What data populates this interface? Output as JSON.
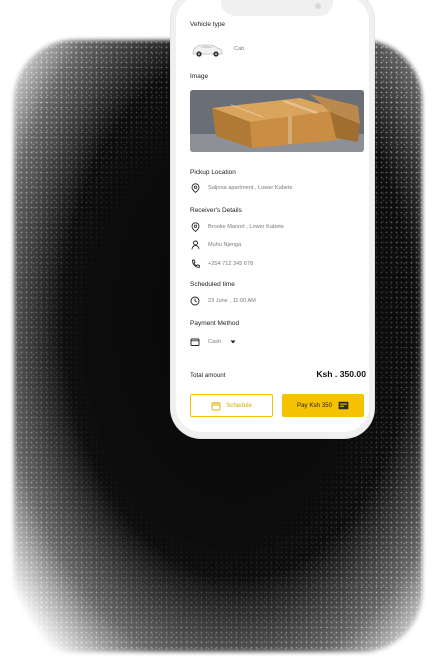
{
  "vehicle": {
    "title": "Vehicle type",
    "type": "Cab"
  },
  "image": {
    "title": "Image"
  },
  "pickup": {
    "title": "Pickup Location",
    "address": "Saljona apartment , Lower Kabete"
  },
  "receiver": {
    "title": "Receiver's Details",
    "address": "Brooke Manort , Lower Kabete",
    "name": "Muhu Njenga",
    "phone": "+254 712 345 678"
  },
  "schedule": {
    "title": "Scheduled time",
    "time": "23 June , 11:00 AM"
  },
  "payment": {
    "title": "Payment Method",
    "method": "Cash"
  },
  "total": {
    "label": "Total amount",
    "value": "Ksh . 350.00"
  },
  "actions": {
    "schedule_label": "Schedule",
    "pay_label": "Pay Ksh 350"
  },
  "colors": {
    "accent": "#f5c200",
    "muted_text": "#7a7a7a"
  },
  "icons": {
    "pickup": "location-pin-icon",
    "receiver_address": "location-pin-icon",
    "receiver_name": "person-icon",
    "receiver_phone": "phone-icon",
    "time": "clock-icon",
    "payment": "wallet-icon",
    "dropdown": "caret-down-icon",
    "schedule_button": "calendar-icon",
    "pay_button": "cash-icon"
  }
}
